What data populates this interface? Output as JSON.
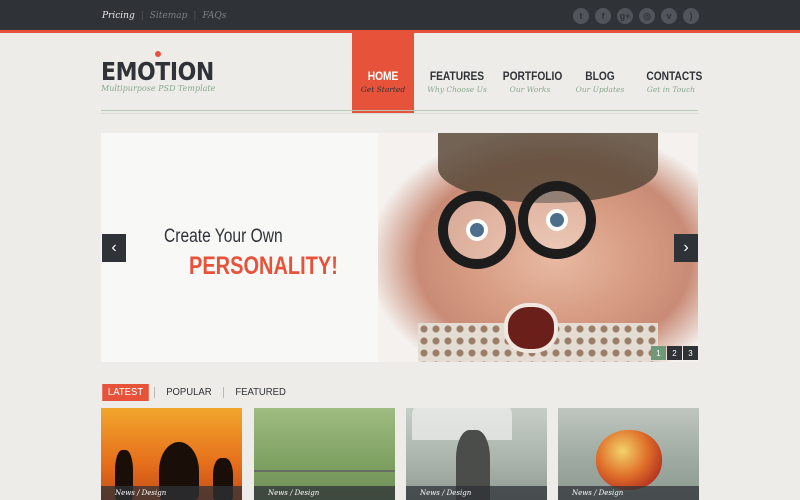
{
  "topbar": {
    "links": [
      {
        "label": "Pricing",
        "active": true
      },
      {
        "label": "Sitemap",
        "active": false
      },
      {
        "label": "FAQs",
        "active": false
      }
    ],
    "social_icons": [
      "twitter-icon",
      "facebook-icon",
      "google-plus-icon",
      "dribbble-icon",
      "vimeo-icon",
      "rss-icon"
    ]
  },
  "header": {
    "logo": "EMOTION",
    "tagline": "Multipurpose PSD Template"
  },
  "nav": [
    {
      "label": "HOME",
      "sub": "Get Started",
      "active": true
    },
    {
      "label": "FEATURES",
      "sub": "Why Choose Us",
      "active": false
    },
    {
      "label": "PORTFOLIO",
      "sub": "Our Works",
      "active": false
    },
    {
      "label": "BLOG",
      "sub": "Our Updates",
      "active": false
    },
    {
      "label": "CONTACTS",
      "sub": "Get in Touch",
      "active": false
    }
  ],
  "slider": {
    "line1": "Create Your Own",
    "line2": "PERSONALITY!",
    "prev_glyph": "‹",
    "next_glyph": "›",
    "pages": [
      "1",
      "2",
      "3"
    ],
    "active_page": "1"
  },
  "tabs": [
    {
      "label": "LATEST",
      "active": true
    },
    {
      "label": "POPULAR",
      "active": false
    },
    {
      "label": "FEATURED",
      "active": false
    }
  ],
  "thumbs": [
    {
      "caption": "News / Design"
    },
    {
      "caption": "News / Design"
    },
    {
      "caption": "News / Design"
    },
    {
      "caption": "News / Design"
    }
  ],
  "colors": {
    "accent": "#e7533a",
    "dark": "#2f3237",
    "green": "#6e9878",
    "background": "#eeece8"
  }
}
